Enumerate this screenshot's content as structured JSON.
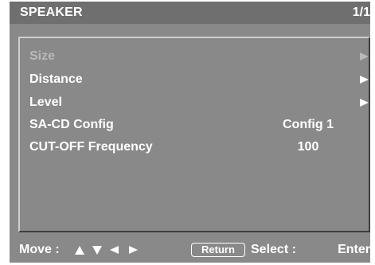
{
  "header": {
    "title": "SPEAKER",
    "page": "1/1"
  },
  "menu": {
    "items": [
      {
        "label": "Size",
        "value": "",
        "submenu": true,
        "enabled": false
      },
      {
        "label": "Distance",
        "value": "",
        "submenu": true,
        "enabled": true
      },
      {
        "label": "Level",
        "value": "",
        "submenu": true,
        "enabled": true
      },
      {
        "label": "SA-CD Config",
        "value": "Config 1",
        "submenu": false,
        "enabled": true
      },
      {
        "label": "CUT-OFF Frequency",
        "value": "100",
        "submenu": false,
        "enabled": true
      }
    ]
  },
  "footer": {
    "move_label": "Move :",
    "move_icons": [
      "arrow-up",
      "arrow-down",
      "arrow-left",
      "arrow-right"
    ],
    "return_label": "Return",
    "select_label": "Select :",
    "select_value": "Enter"
  },
  "colors": {
    "background": "#898989",
    "title_bar": "#6f6f6f",
    "text": "#ffffff",
    "disabled_text": "#b9b9b9"
  }
}
